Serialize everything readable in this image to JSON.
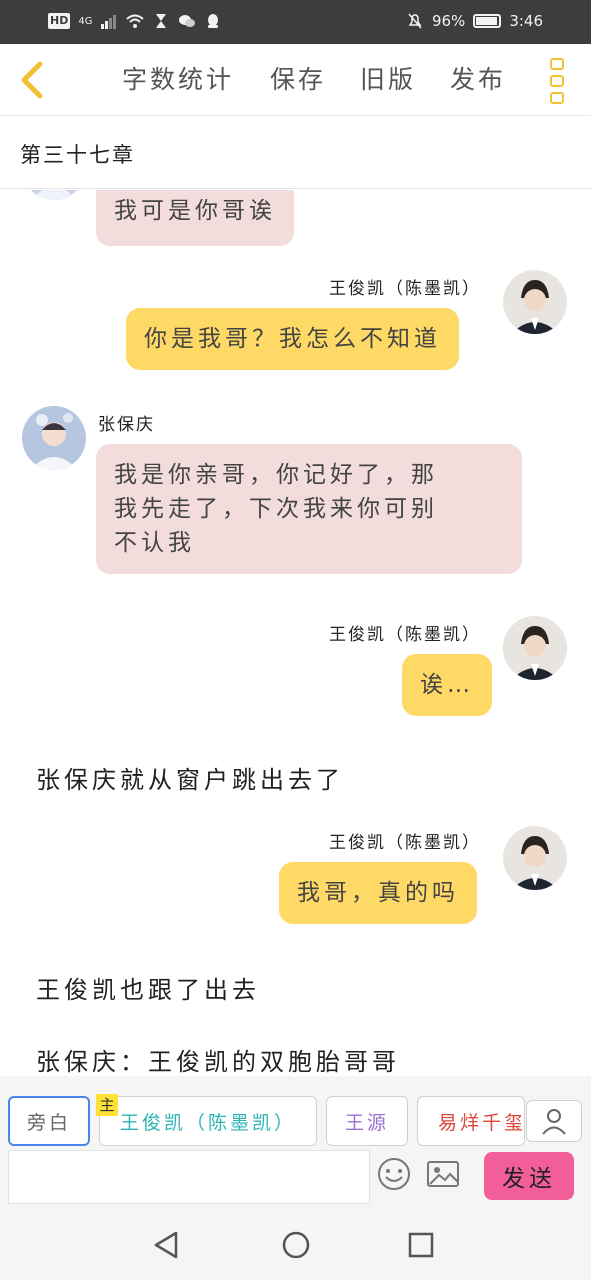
{
  "status_bar": {
    "network": "HD",
    "signal": "4G",
    "battery": "96%",
    "time": "3:46"
  },
  "toolbar": {
    "word_count": "字数统计",
    "save": "保存",
    "old_version": "旧版",
    "publish": "发布"
  },
  "chapter_title": "第三十七章",
  "messages": [
    {
      "speaker": "",
      "text": "我可是你哥诶",
      "side": "left"
    },
    {
      "speaker": "王俊凯（陈墨凯）",
      "text": "你是我哥？我怎么不知道",
      "side": "right"
    },
    {
      "speaker": "张保庆",
      "text": "我是你亲哥，你记好了，那我先走了，下次我来你可别不认我",
      "lines": [
        "我是你亲哥，你记好了，那",
        "我先走了，下次我来你可别",
        "不认我"
      ],
      "side": "left"
    },
    {
      "speaker": "王俊凯（陈墨凯）",
      "text": "诶…",
      "side": "right"
    },
    {
      "narration": "张保庆就从窗户跳出去了"
    },
    {
      "speaker": "王俊凯（陈墨凯）",
      "text": "我哥，真的吗",
      "side": "right"
    },
    {
      "narration": "王俊凯也跟了出去"
    },
    {
      "narration": "张保庆：王俊凯的双胞胎哥哥"
    }
  ],
  "roles": {
    "aside": "旁白",
    "main_tag": "主",
    "main": "王俊凯（陈墨凯）",
    "yuan": "王源",
    "yi": "易烊千玺"
  },
  "input": {
    "placeholder": ""
  },
  "send_label": "发送",
  "colors": {
    "accent_yellow": "#ffd966",
    "bubble_pink": "#f2dcdc",
    "send_pink": "#f25e9a",
    "icon_gold": "#f1c232"
  }
}
